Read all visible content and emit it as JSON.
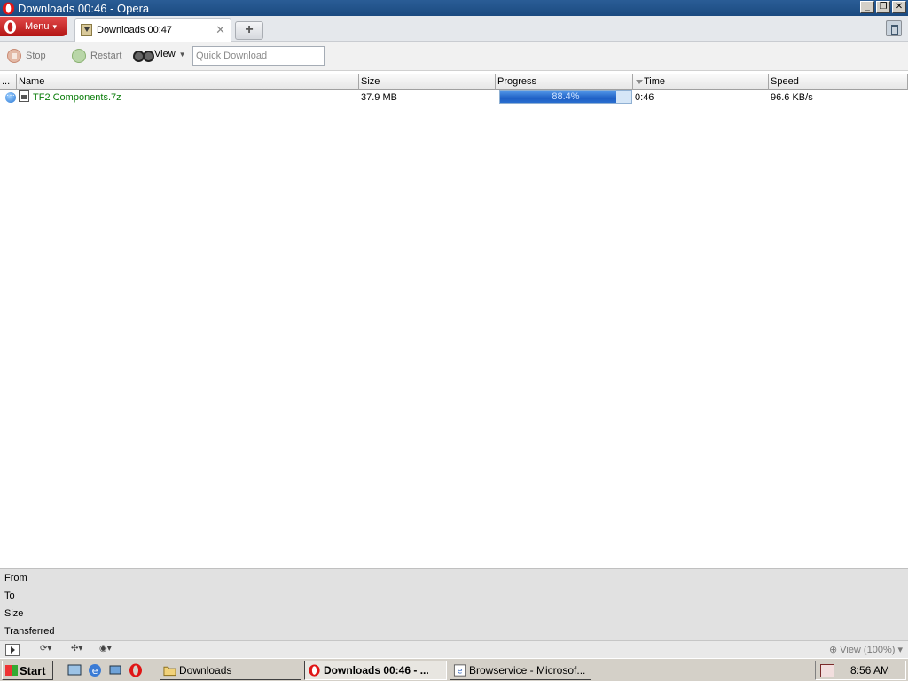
{
  "window": {
    "title": "Downloads 00:46 - Opera",
    "controls": [
      "minimize",
      "restore",
      "close"
    ]
  },
  "tabbar": {
    "menu_label": "Menu",
    "tabs": [
      {
        "label": "Downloads 00:47",
        "icon": "download-icon"
      }
    ],
    "new_tab": "+"
  },
  "toolbar": {
    "stop_label": "Stop",
    "restart_label": "Restart",
    "view_label": "View",
    "quick_download_placeholder": "Quick Download"
  },
  "table": {
    "columns": [
      "...",
      "Name",
      "Size",
      "Progress",
      "Time",
      "Speed"
    ],
    "sorted_column": "Time",
    "rows": [
      {
        "name": "TF2 Components.7z",
        "size": "37.9 MB",
        "progress": 0.884,
        "progress_label": "88.4%",
        "time": "0:46",
        "speed": "96.6 KB/s"
      }
    ]
  },
  "details": {
    "labels": [
      "From",
      "To",
      "Size",
      "Transferred"
    ]
  },
  "statusbar": {
    "zoom_label": "View (100%)"
  },
  "taskbar": {
    "start_label": "Start",
    "tasks": [
      {
        "label": "Downloads",
        "active": false
      },
      {
        "label": "Downloads 00:46 - ...",
        "active": true
      },
      {
        "label": "Browservice - Microsof...",
        "active": false
      }
    ],
    "clock": "8:56 AM"
  },
  "colors": {
    "titlebar": "#1b4a80",
    "menu_button": "#c41e1e",
    "progress_fill": "#1e5fc4",
    "file_name": "#0a7d0a"
  }
}
